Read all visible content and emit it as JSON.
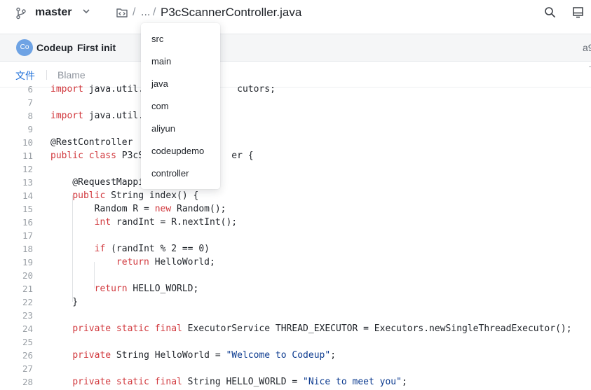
{
  "header": {
    "branch": "master",
    "breadcrumb_ellipsis": "...",
    "separator": "/",
    "file_name": "P3cScannerController.java",
    "icons": [
      "branch-icon",
      "chevron-down-icon",
      "repo-icon",
      "search-icon",
      "panel-icon"
    ]
  },
  "commit": {
    "avatar_initials": "Co",
    "author": "Codeup",
    "message": "First init",
    "hash": "a9"
  },
  "tabs": {
    "file": "文件",
    "blame": "Blame"
  },
  "path_dropdown": {
    "items": [
      "src",
      "main",
      "java",
      "com",
      "aliyun",
      "codeupdemo",
      "controller"
    ]
  },
  "code": {
    "lines": [
      {
        "n": "6",
        "segs": [
          [
            "kw",
            "import"
          ],
          [
            "",
            " java.util."
          ],
          [
            "",
            "                 "
          ],
          [
            "",
            "cutors;"
          ]
        ]
      },
      {
        "n": "7",
        "segs": []
      },
      {
        "n": "8",
        "segs": [
          [
            "kw",
            "import"
          ],
          [
            "",
            " java.util."
          ]
        ]
      },
      {
        "n": "9",
        "segs": []
      },
      {
        "n": "10",
        "segs": [
          [
            "",
            "@RestController"
          ]
        ]
      },
      {
        "n": "11",
        "segs": [
          [
            "kw",
            "public class"
          ],
          [
            "",
            " P3cS"
          ],
          [
            "",
            "                "
          ],
          [
            "",
            "er {"
          ]
        ]
      },
      {
        "n": "12",
        "segs": []
      },
      {
        "n": "13",
        "segs": [
          [
            "",
            "    @RequestMappi"
          ]
        ]
      },
      {
        "n": "14",
        "segs": [
          [
            "",
            "    "
          ],
          [
            "kw",
            "public"
          ],
          [
            "",
            " String index() {"
          ]
        ]
      },
      {
        "n": "15",
        "segs": [
          [
            "",
            "        Random R = "
          ],
          [
            "kw",
            "new"
          ],
          [
            "",
            " Random();"
          ]
        ]
      },
      {
        "n": "16",
        "segs": [
          [
            "",
            "        "
          ],
          [
            "kw",
            "int"
          ],
          [
            "",
            " randInt = R.nextInt();"
          ]
        ]
      },
      {
        "n": "17",
        "segs": []
      },
      {
        "n": "18",
        "segs": [
          [
            "",
            "        "
          ],
          [
            "kw",
            "if"
          ],
          [
            "",
            " (randInt % 2 == 0)"
          ]
        ]
      },
      {
        "n": "19",
        "segs": [
          [
            "",
            "            "
          ],
          [
            "kw",
            "return"
          ],
          [
            "",
            " HelloWorld;"
          ]
        ]
      },
      {
        "n": "20",
        "segs": []
      },
      {
        "n": "21",
        "segs": [
          [
            "",
            "        "
          ],
          [
            "kw",
            "return"
          ],
          [
            "",
            " HELLO_WORLD;"
          ]
        ]
      },
      {
        "n": "22",
        "segs": [
          [
            "",
            "    }"
          ]
        ]
      },
      {
        "n": "23",
        "segs": []
      },
      {
        "n": "24",
        "segs": [
          [
            "",
            "    "
          ],
          [
            "kw",
            "private static final"
          ],
          [
            "",
            " ExecutorService THREAD_EXECUTOR = Executors.newSingleThreadExecutor();"
          ]
        ]
      },
      {
        "n": "25",
        "segs": []
      },
      {
        "n": "26",
        "segs": [
          [
            "",
            "    "
          ],
          [
            "kw",
            "private"
          ],
          [
            "",
            " String HelloWorld = "
          ],
          [
            "str",
            "\"Welcome to Codeup\""
          ],
          [
            "",
            ";"
          ]
        ]
      },
      {
        "n": "27",
        "segs": []
      },
      {
        "n": "28",
        "segs": [
          [
            "",
            "    "
          ],
          [
            "kw",
            "private static final"
          ],
          [
            "",
            " String HELLO_WORLD = "
          ],
          [
            "str",
            "\"Nice to meet you\""
          ],
          [
            "",
            ";"
          ]
        ]
      }
    ]
  }
}
